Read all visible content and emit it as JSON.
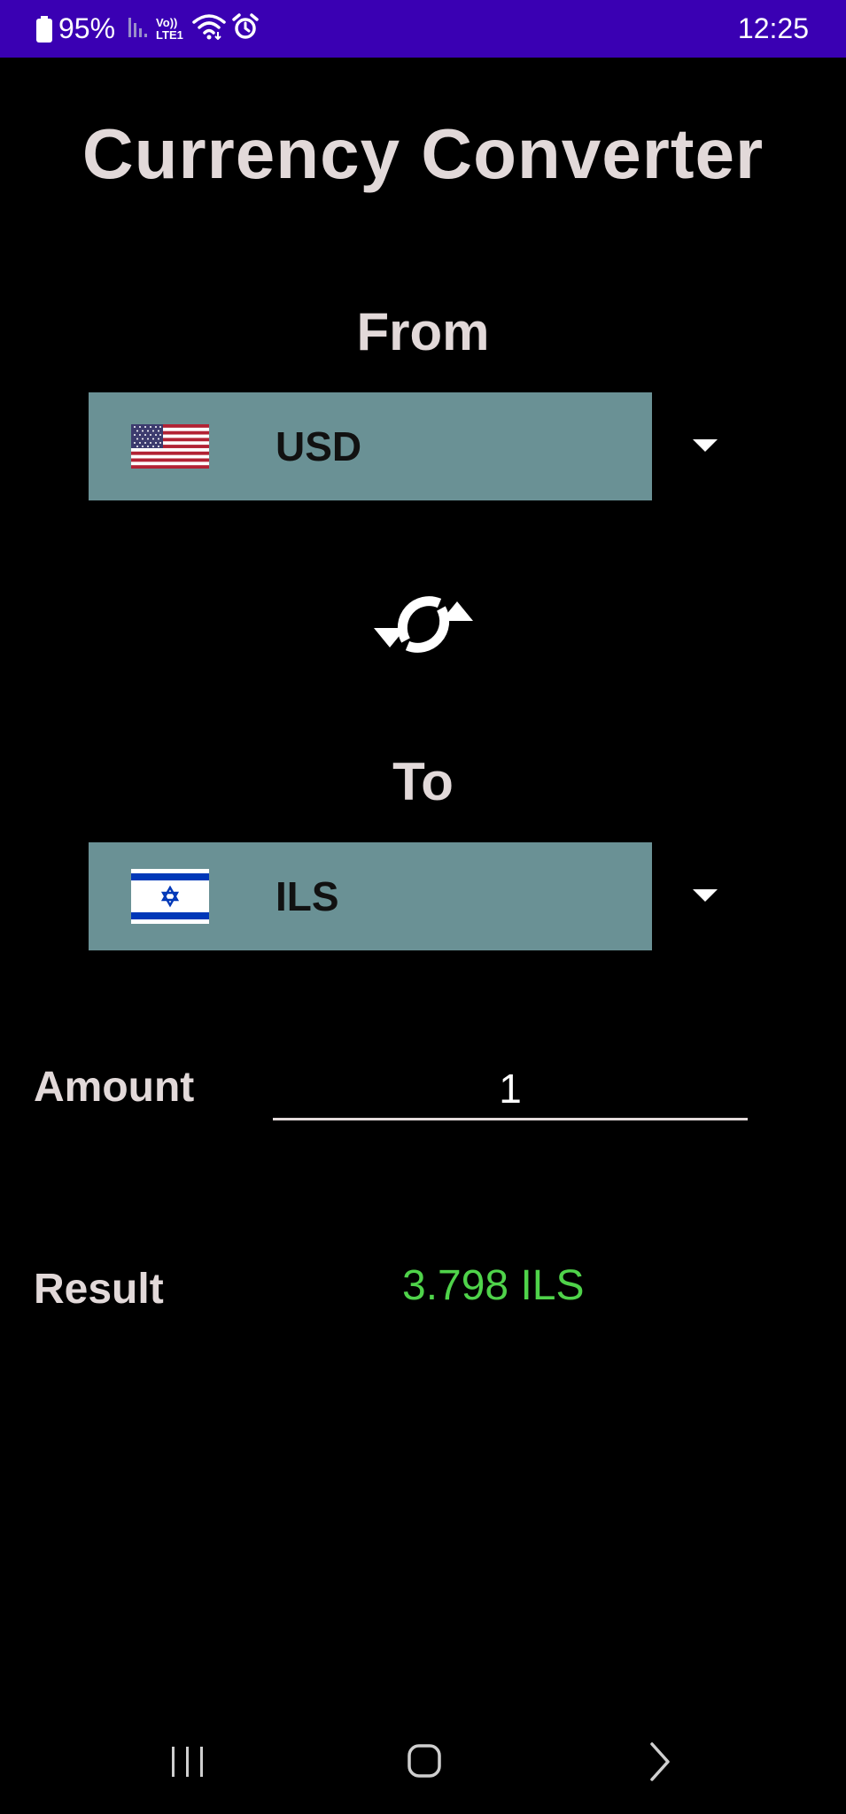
{
  "status_bar": {
    "battery_percent": "95%",
    "time": "12:25",
    "volte_label_top": "Vo))",
    "volte_label_bottom": "LTE1",
    "icons": [
      "battery-icon",
      "signal-icon",
      "volte-icon",
      "wifi-icon",
      "alarm-icon"
    ],
    "background_color": "#3a00b3"
  },
  "header": {
    "title": "Currency Converter"
  },
  "from": {
    "label": "From",
    "currency_code": "USD",
    "flag": "us-flag-icon"
  },
  "to": {
    "label": "To",
    "currency_code": "ILS",
    "flag": "israel-flag-icon"
  },
  "swap": {
    "icon": "swap-refresh-icon"
  },
  "amount": {
    "label": "Amount",
    "value": "1"
  },
  "result": {
    "label": "Result",
    "value": "3.798 ILS",
    "color": "#4fd34a"
  },
  "nav_bar": {
    "icons": [
      "recent-apps-icon",
      "home-icon",
      "back-icon"
    ]
  },
  "colors": {
    "background": "#000000",
    "select_background": "#6a9195",
    "label_text": "#e2d9d9"
  }
}
